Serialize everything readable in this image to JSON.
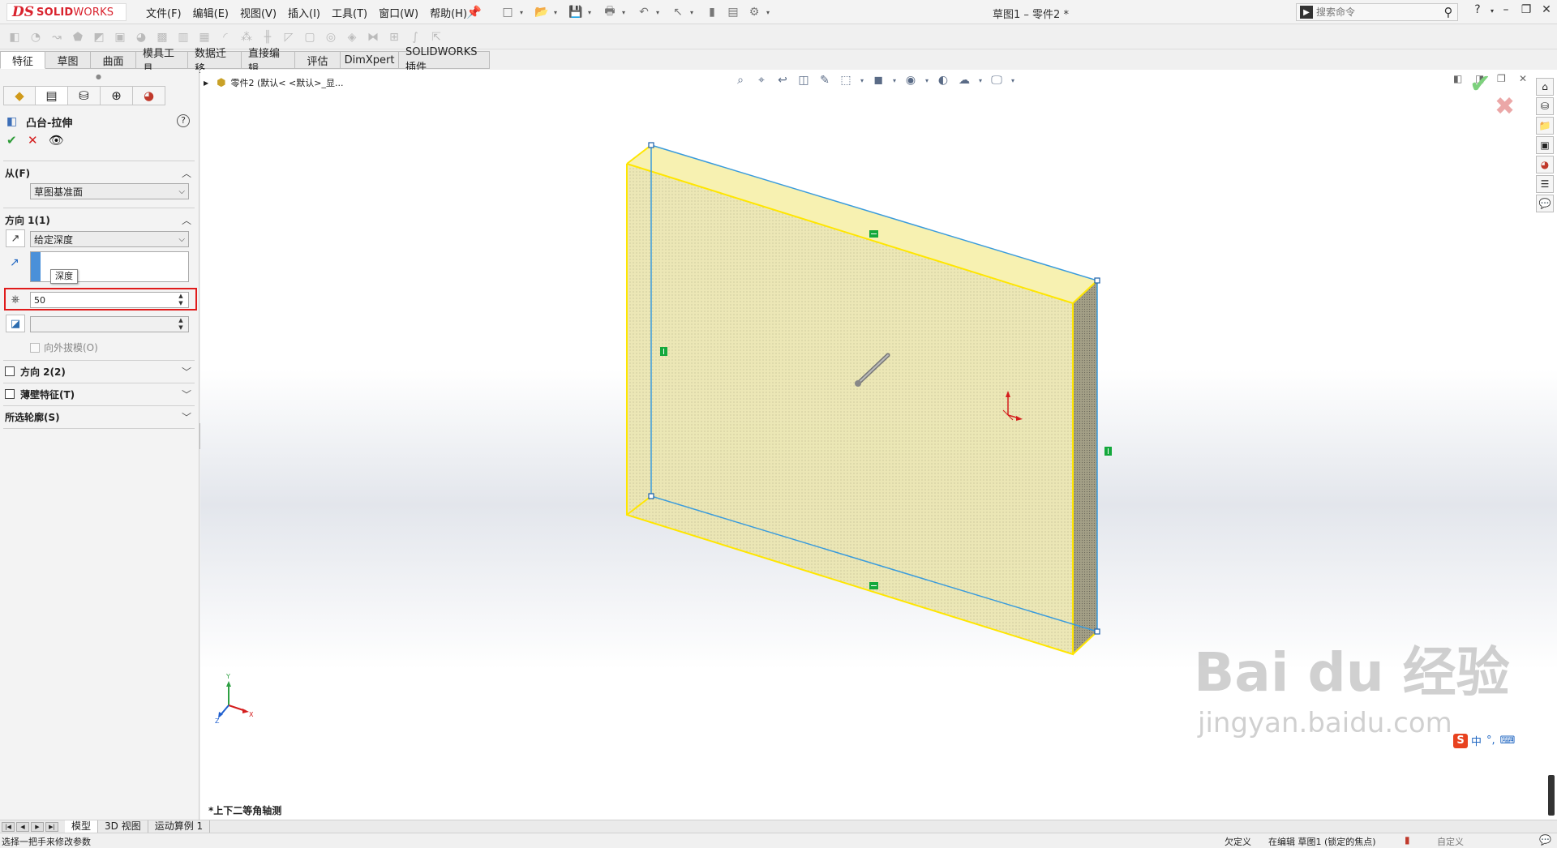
{
  "app": {
    "logo_ds": "DS",
    "logo_solid": "SOLID",
    "logo_works": "WORKS",
    "doc_title": "草图1 – 零件2 *"
  },
  "menu": [
    "文件(F)",
    "编辑(E)",
    "视图(V)",
    "插入(I)",
    "工具(T)",
    "窗口(W)",
    "帮助(H)"
  ],
  "search": {
    "placeholder": "搜索命令"
  },
  "tabs": [
    "特征",
    "草图",
    "曲面",
    "模具工具",
    "数据迁移",
    "直接编辑",
    "评估",
    "DimXpert",
    "SOLIDWORKS 插件"
  ],
  "active_tab": "特征",
  "property_manager": {
    "title": "凸台-拉伸",
    "from": {
      "label": "从(F)",
      "value": "草图基准面"
    },
    "direction1": {
      "label": "方向 1(1)",
      "end_condition": "给定深度",
      "tooltip": "深度",
      "depth": "50",
      "draft_label": "向外拔模(O)"
    },
    "direction2_label": "方向 2(2)",
    "thin_feature_label": "薄壁特征(T)",
    "selected_contours_label": "所选轮廓(S)"
  },
  "viewport": {
    "tree_path": "零件2  (默认< <默认>_显...",
    "view_label": "*上下二等角轴测",
    "triad": {
      "x": "X",
      "y": "Y",
      "z": "Z"
    },
    "ime": {
      "badge": "S",
      "lang": "中",
      "punct": "°,",
      "kbd": "⌨"
    },
    "watermark": "Bai du 经验",
    "watermark_url": "jingyan.baidu.com"
  },
  "bottom_tabs": [
    "模型",
    "3D 视图",
    "运动算例 1"
  ],
  "status": {
    "hint": "选择一把手来修改参数",
    "underdefined": "欠定义",
    "editing": "在编辑 草图1 (锁定的焦点)",
    "custom": "自定义"
  },
  "colors": {
    "accent_red": "#d9232e",
    "highlight_red": "#e01b1b",
    "face_yellow": "#f4f0b8",
    "edge_yellow": "#ffe600",
    "edge_blue": "#3a9bdc",
    "ok_green": "#2e9c38"
  }
}
